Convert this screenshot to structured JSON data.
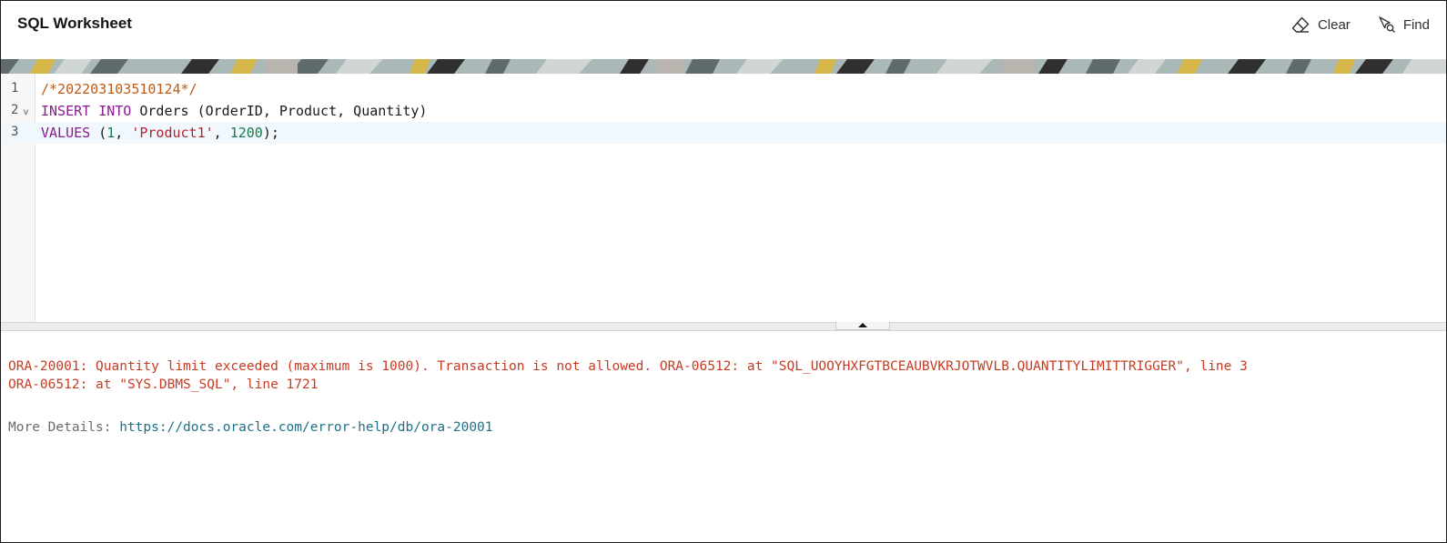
{
  "header": {
    "title": "SQL Worksheet",
    "clear_label": "Clear",
    "find_label": "Find"
  },
  "editor": {
    "line_numbers": [
      "1",
      "2",
      "3"
    ],
    "fold_marker": "v",
    "line1": {
      "comment": "/*202203103510124*/"
    },
    "line2": {
      "kw_insert": "INSERT",
      "kw_into": "INTO",
      "rest": " Orders (OrderID, Product, Quantity)"
    },
    "line3": {
      "kw_values": "VALUES",
      "open": " (",
      "num1": "1",
      "sep1": ", ",
      "str1": "'Product1'",
      "sep2": ", ",
      "num2": "1200",
      "close": ");"
    }
  },
  "output": {
    "error_line1": "ORA-20001: Quantity limit exceeded (maximum is 1000). Transaction is not allowed. ORA-06512: at \"SQL_UOOYHXFGTBCEAUBVKRJOTWVLB.QUANTITYLIMITTRIGGER\", line 3",
    "error_line2": "ORA-06512: at \"SYS.DBMS_SQL\", line 1721",
    "details_label": "More Details: ",
    "details_link": "https://docs.oracle.com/error-help/db/ora-20001"
  },
  "colors": {
    "keyword": "#8a1c8e",
    "comment": "#c05a10",
    "number": "#1b7a4c",
    "string": "#b0252b",
    "error": "#c73b22",
    "link": "#1e6f86"
  }
}
